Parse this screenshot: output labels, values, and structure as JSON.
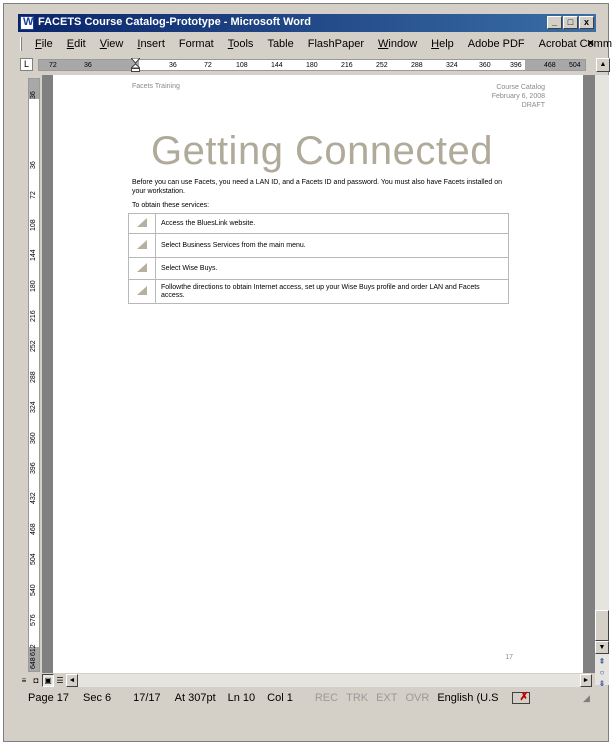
{
  "window": {
    "title": "FACETS Course Catalog-Prototype - Microsoft Word",
    "minimize": "_",
    "maximize": "□",
    "close": "x",
    "doc_close": "×"
  },
  "menu": [
    "File",
    "Edit",
    "View",
    "Insert",
    "Format",
    "Tools",
    "Table",
    "FlashPaper",
    "Window",
    "Help",
    "Adobe PDF",
    "Acrobat Comments"
  ],
  "ruler": {
    "tab_selector": "L",
    "marks": [
      "72",
      "36",
      "36",
      "72",
      "108",
      "144",
      "180",
      "216",
      "252",
      "288",
      "324",
      "360",
      "396",
      "468",
      "504"
    ],
    "vmarks": [
      "36",
      "36",
      "72",
      "108",
      "144",
      "180",
      "216",
      "252",
      "288",
      "324",
      "360",
      "396",
      "432",
      "468",
      "504",
      "540",
      "576",
      "612",
      "648"
    ]
  },
  "page": {
    "header_left": "Facets Training",
    "header_right_1": "Course Catalog",
    "header_right_2": "February 6, 2008",
    "header_right_3": "DRAFT",
    "heading": "Getting Connected",
    "intro": "Before you can use Facets, you need a LAN ID, and a Facets ID and password. You must also have Facets installed on your workstation.",
    "obtain": "To obtain these services:",
    "steps": [
      "Access the BluesLink website.",
      "Select Business Services from the main menu.",
      "Select Wise Buys.",
      "Followthe directions to obtain Internet access, set up your Wise Buys profile and order LAN and Facets access."
    ],
    "page_number": "17"
  },
  "status": {
    "page": "Page 17",
    "sec": "Sec 6",
    "pages": "17/17",
    "at": "At 307pt",
    "ln": "Ln 10",
    "col": "Col 1",
    "rec": "REC",
    "trk": "TRK",
    "ext": "EXT",
    "ovr": "OVR",
    "lang": "English (U.S"
  },
  "icons": {
    "app": "word-icon",
    "step": "triangle-bullet-icon",
    "spell": "spelling-check-icon"
  },
  "colors": {
    "titlebar_start": "#0a246a",
    "titlebar_end": "#3a6ea5",
    "heading": "#b0aa9a",
    "bullet": "#b7b0a0",
    "doc_background": "#808080"
  }
}
